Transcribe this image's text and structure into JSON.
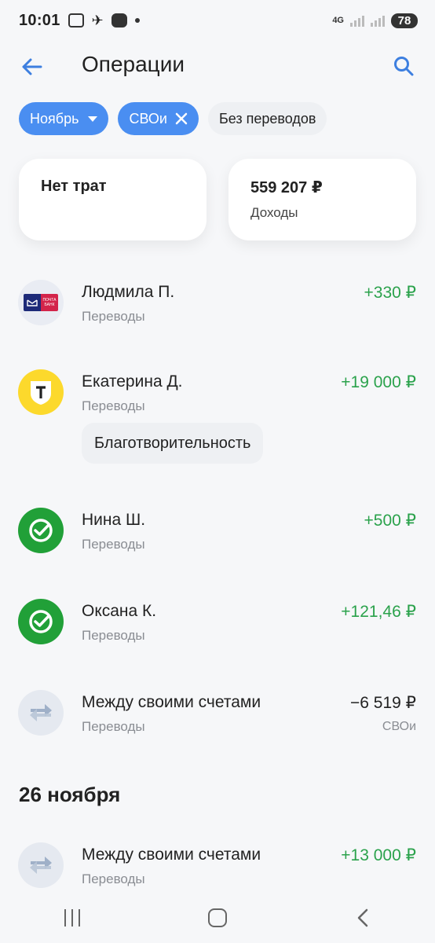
{
  "status_bar": {
    "time": "10:01",
    "network": "4G",
    "battery": "78"
  },
  "header": {
    "title": "Операции",
    "back_icon": "arrow-left-icon",
    "search_icon": "search-icon"
  },
  "filters": [
    {
      "label": "Ноябрь",
      "active": true
    },
    {
      "label": "СВОи",
      "active": true
    },
    {
      "label": "Без переводов",
      "active": false
    }
  ],
  "summary": {
    "expenses": {
      "main": "Нет трат"
    },
    "income": {
      "main": "559 207 ₽",
      "sub": "Доходы"
    }
  },
  "transactions_group1": [
    {
      "name": "Людмила П.",
      "category": "Переводы",
      "amount": "+330 ₽",
      "avatar": "pochta-bank-logo"
    },
    {
      "name": "Екатерина Д.",
      "category": "Переводы",
      "amount": "+19 000 ₽",
      "avatar": "t-bank-logo",
      "tag": "Благотворительность"
    },
    {
      "name": "Нина Ш.",
      "category": "Переводы",
      "amount": "+500 ₽",
      "avatar": "sber-logo"
    },
    {
      "name": "Оксана К.",
      "category": "Переводы",
      "amount": "+121,46 ₽",
      "avatar": "sber-logo"
    },
    {
      "name": "Между своими счетами",
      "category": "Переводы",
      "amount": "−6 519 ₽",
      "account": "СВОи",
      "avatar": "transfer-icon"
    }
  ],
  "date_header": "26 ноября",
  "transactions_group2": [
    {
      "name": "Между своими счетами",
      "category": "Переводы",
      "amount": "+13 000 ₽",
      "avatar": "transfer-icon"
    }
  ],
  "colors": {
    "accent": "#4a8ef1",
    "positive": "#2ba24c",
    "muted": "#8a8d93",
    "background": "#f6f7f9"
  }
}
